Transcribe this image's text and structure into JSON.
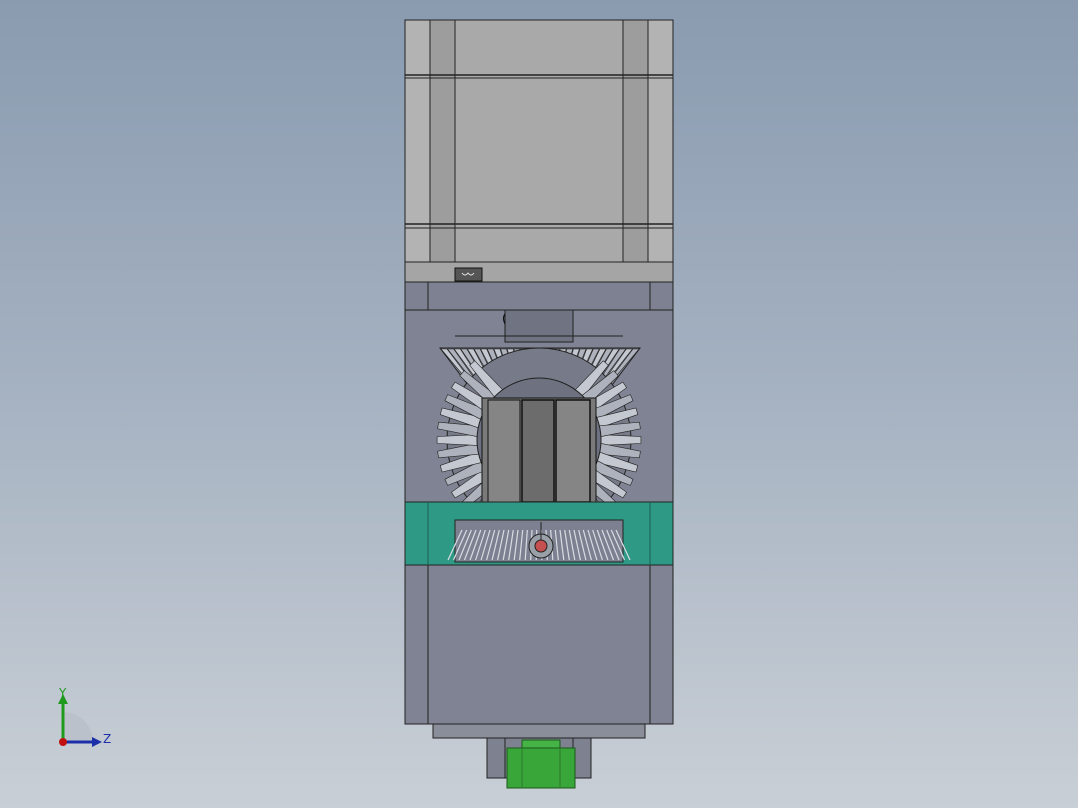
{
  "viewport": {
    "background_top": "#8a9bb0",
    "background_bottom": "#c9cfd6"
  },
  "model": {
    "motor_color": "#a9a9a9",
    "housing_color": "#7f8393",
    "bracket_color": "#2e9a86",
    "coupling_color": "#3aa63a",
    "gear_color": "#c4c8d0"
  },
  "triad": {
    "y_label": "Y",
    "z_label": "Z",
    "x_color": "#c01010",
    "y_color": "#1f9a1f",
    "z_color": "#1b2fa8"
  }
}
